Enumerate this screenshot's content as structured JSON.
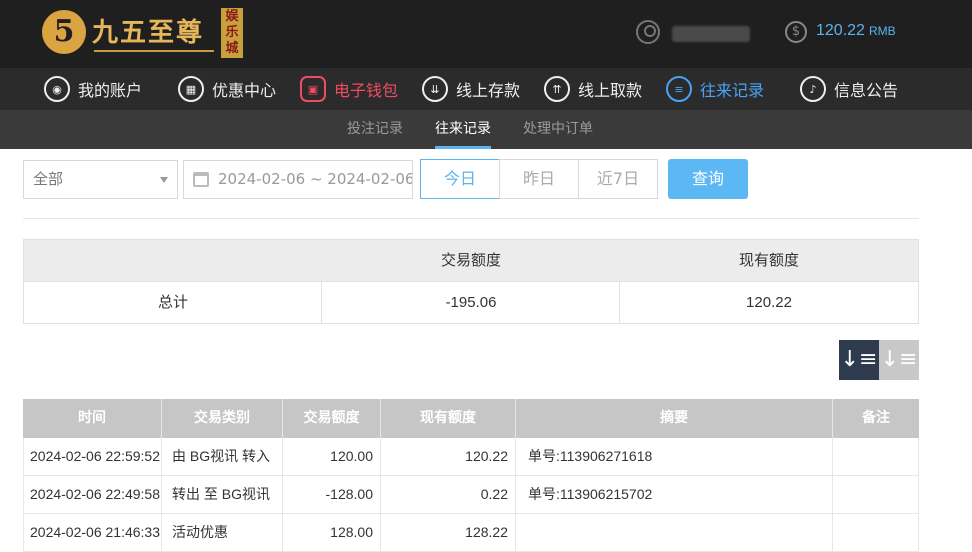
{
  "header": {
    "logo_numeral": "5",
    "logo_text": "九五至尊",
    "logo_badge": "娱乐城",
    "balance_value": "120.22",
    "balance_unit": "RMB"
  },
  "nav": {
    "items": [
      {
        "label": "我的账户",
        "icon": "user-icon"
      },
      {
        "label": "优惠中心",
        "icon": "gift-icon"
      },
      {
        "label": "电子钱包",
        "icon": "wallet-icon"
      },
      {
        "label": "线上存款",
        "icon": "deposit-icon"
      },
      {
        "label": "线上取款",
        "icon": "withdraw-icon"
      },
      {
        "label": "往来记录",
        "icon": "record-icon"
      },
      {
        "label": "信息公告",
        "icon": "bell-icon"
      }
    ]
  },
  "subnav": {
    "items": [
      "投注记录",
      "往来记录",
      "处理中订单"
    ],
    "active": "往来记录"
  },
  "filter": {
    "type_value": "全部",
    "date_range": "2024-02-06 ~ 2024-02-06",
    "today": "今日",
    "yesterday": "昨日",
    "last7": "近7日",
    "query": "查询"
  },
  "summary": {
    "col_amount": "交易额度",
    "col_balance": "现有额度",
    "row_label": "总计",
    "amount": "-195.06",
    "balance": "120.22"
  },
  "colors": {
    "accent_blue": "#5bb3f0",
    "wallet_red": "#ef4b63",
    "topbar_bg": "#1f1f1f"
  },
  "table": {
    "headers": [
      "时间",
      "交易类别",
      "交易额度",
      "现有额度",
      "摘要",
      "备注"
    ],
    "rows": [
      {
        "time": "2024-02-06 22:59:52",
        "type": "由 BG视讯 转入",
        "amount": "120.00",
        "balance": "120.22",
        "summary": "单号:113906271618",
        "note": ""
      },
      {
        "time": "2024-02-06 22:49:58",
        "type": "转出 至 BG视讯",
        "amount": "-128.00",
        "balance": "0.22",
        "summary": "单号:113906215702",
        "note": ""
      },
      {
        "time": "2024-02-06 21:46:33",
        "type": "活动优惠",
        "amount": "128.00",
        "balance": "128.22",
        "summary": "",
        "note": ""
      }
    ]
  }
}
